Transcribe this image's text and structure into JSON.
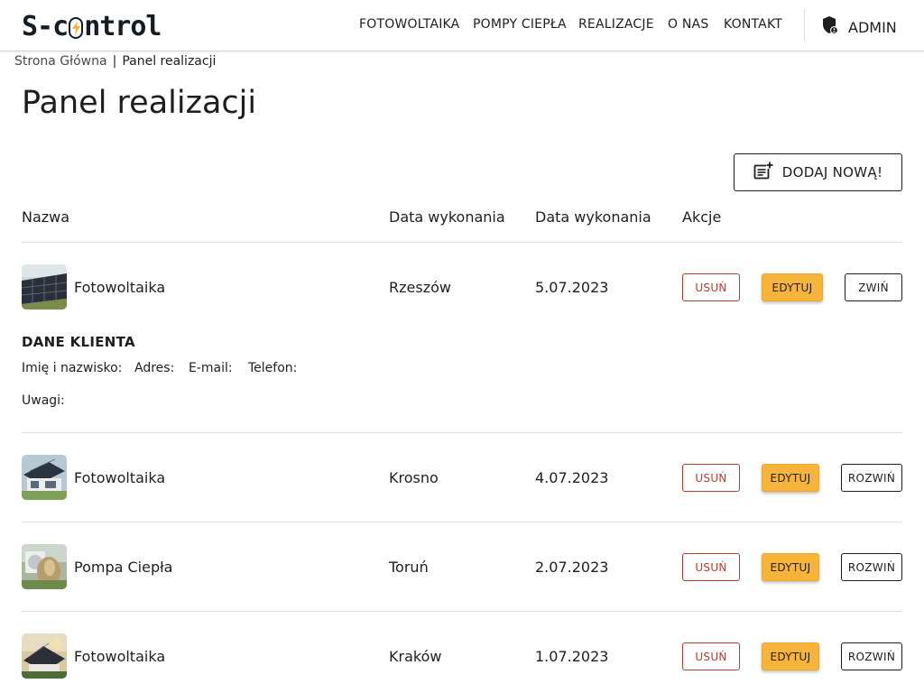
{
  "brand": {
    "logo_left": "S-c",
    "logo_right": "ntrol"
  },
  "nav": {
    "items": [
      {
        "label": "FOTOWOLTAIKA"
      },
      {
        "label": "POMPY CIEPŁA"
      },
      {
        "label": "REALIZACJE"
      },
      {
        "label": "O NAS"
      },
      {
        "label": "KONTAKT"
      }
    ],
    "admin_label": "ADMIN"
  },
  "breadcrumb": {
    "home": "Strona Główna",
    "separator": "|",
    "current": "Panel realizacji"
  },
  "page_title": "Panel realizacji",
  "add_button_label": "DODAJ NOWĄ!",
  "table": {
    "headers": [
      "Nazwa",
      "Data wykonania",
      "Data wykonania",
      "Akcje"
    ],
    "rows": [
      {
        "name": "Fotowoltaika",
        "location": "Rzeszów",
        "date": "5.07.2023",
        "delete": "USUŃ",
        "edit": "EDYTUJ",
        "toggle": "ZWIŃ",
        "expanded": true,
        "thumb": "solar-field"
      },
      {
        "name": "Fotowoltaika",
        "location": "Krosno",
        "date": "4.07.2023",
        "delete": "USUŃ",
        "edit": "EDYTUJ",
        "toggle": "ROZWIŃ",
        "expanded": false,
        "thumb": "house-roof"
      },
      {
        "name": "Pompa Ciepła",
        "location": "Toruń",
        "date": "2.07.2023",
        "delete": "USUŃ",
        "edit": "EDYTUJ",
        "toggle": "ROZWIŃ",
        "expanded": false,
        "thumb": "heat-pump"
      },
      {
        "name": "Fotowoltaika",
        "location": "Kraków",
        "date": "1.07.2023",
        "delete": "USUŃ",
        "edit": "EDYTUJ",
        "toggle": "ROZWIŃ",
        "expanded": false,
        "thumb": "house-sunset"
      }
    ]
  },
  "details": {
    "title": "DANE KLIENTA",
    "name_label": "Imię i nazwisko:",
    "address_label": "Adres:",
    "email_label": "E-mail:",
    "phone_label": "Telefon:",
    "notes_label": "Uwagi:"
  },
  "colors": {
    "accent": "#f6b43a",
    "danger": "#c0392b",
    "text": "#1e1e1e",
    "divider": "#e2e2e2"
  }
}
